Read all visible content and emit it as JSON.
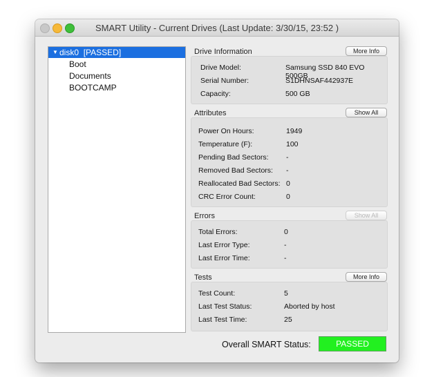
{
  "window": {
    "title": "SMART Utility - Current Drives (Last Update: 3/30/15, 23:52 )"
  },
  "tree": {
    "disk": {
      "name": "disk0",
      "status": "[PASSED]"
    },
    "volumes": [
      "Boot",
      "Documents",
      "BOOTCAMP"
    ]
  },
  "drive_info": {
    "title": "Drive Information",
    "button": "More Info",
    "rows": [
      {
        "label": "Drive Model:",
        "value": "Samsung SSD 840 EVO 500GB"
      },
      {
        "label": "Serial Number:",
        "value": "S1DHNSAF442937E"
      },
      {
        "label": "Capacity:",
        "value": "500 GB"
      }
    ]
  },
  "attributes": {
    "title": "Attributes",
    "button": "Show All",
    "rows": [
      {
        "label": "Power On Hours:",
        "value": "1949"
      },
      {
        "label": "Temperature (F):",
        "value": "100"
      },
      {
        "label": "Pending Bad Sectors:",
        "value": "-"
      },
      {
        "label": "Removed Bad Sectors:",
        "value": "-"
      },
      {
        "label": "Reallocated Bad Sectors:",
        "value": "0"
      },
      {
        "label": "CRC Error Count:",
        "value": "0"
      }
    ]
  },
  "errors": {
    "title": "Errors",
    "button": "Show All",
    "rows": [
      {
        "label": "Total Errors:",
        "value": "0"
      },
      {
        "label": "Last Error Type:",
        "value": "-"
      },
      {
        "label": "Last Error Time:",
        "value": "-"
      }
    ]
  },
  "tests": {
    "title": "Tests",
    "button": "More Info",
    "rows": [
      {
        "label": "Test Count:",
        "value": "5"
      },
      {
        "label": "Last Test Status:",
        "value": "Aborted by host"
      },
      {
        "label": "Last Test Time:",
        "value": "25"
      }
    ]
  },
  "overall": {
    "label": "Overall SMART Status:",
    "status": "PASSED"
  },
  "colors": {
    "selection": "#1b6fe0",
    "status_ok": "#22f020"
  }
}
